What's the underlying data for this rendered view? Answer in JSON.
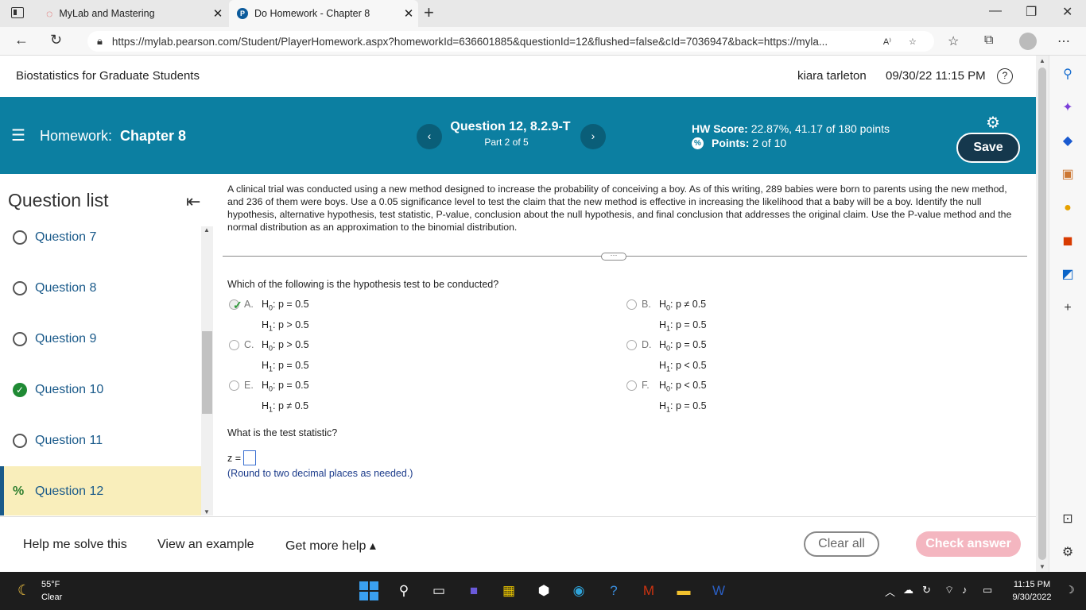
{
  "browser": {
    "tabs": [
      {
        "title": "MyLab and Mastering"
      },
      {
        "title": "Do Homework - Chapter 8"
      }
    ],
    "url": "https://mylab.pearson.com/Student/PlayerHomework.aspx?homeworkId=636601885&questionId=12&flushed=false&cId=7036947&back=https://myla..."
  },
  "header": {
    "course": "Biostatistics for Graduate Students",
    "user": "kiara tarleton",
    "datetime": "09/30/22 11:15 PM"
  },
  "banner": {
    "homework_prefix": "Homework:",
    "homework_name": "Chapter 8",
    "question_title": "Question 12, 8.2.9-T",
    "question_part": "Part 2 of 5",
    "hw_score_label": "HW Score:",
    "hw_score_value": "22.87%, 41.17 of 180 points",
    "points_label": "Points:",
    "points_value": "2 of 10",
    "save_label": "Save"
  },
  "question_list": {
    "title": "Question list",
    "items": [
      {
        "label": "Question 7",
        "status": "unanswered"
      },
      {
        "label": "Question 8",
        "status": "unanswered"
      },
      {
        "label": "Question 9",
        "status": "unanswered"
      },
      {
        "label": "Question 10",
        "status": "correct"
      },
      {
        "label": "Question 11",
        "status": "unanswered"
      },
      {
        "label": "Question 12",
        "status": "partial"
      }
    ]
  },
  "problem": {
    "text": "A clinical trial was conducted using a new method designed to increase the probability of conceiving a boy. As of this writing, 289 babies were born to parents using the new method, and 236 of them were boys. Use a 0.05 significance level to test the claim that the new method is effective in increasing the likelihood that a baby will be a boy. Identify the null hypothesis, alternative hypothesis, test statistic, P-value, conclusion about the null hypothesis, and final conclusion that addresses the original claim. Use the P-value method and the normal distribution as an approximation to the binomial distribution.",
    "q1": "Which of the following is the hypothesis test to be conducted?",
    "options": [
      {
        "letter": "A.",
        "h0": ": p = 0.5",
        "h1": ": p > 0.5",
        "selected": true
      },
      {
        "letter": "B.",
        "h0": ": p ≠ 0.5",
        "h1": ": p = 0.5",
        "selected": false
      },
      {
        "letter": "C.",
        "h0": ": p > 0.5",
        "h1": ": p = 0.5",
        "selected": false
      },
      {
        "letter": "D.",
        "h0": ": p = 0.5",
        "h1": ": p < 0.5",
        "selected": false
      },
      {
        "letter": "E.",
        "h0": ": p = 0.5",
        "h1": ": p ≠ 0.5",
        "selected": false
      },
      {
        "letter": "F.",
        "h0": ": p < 0.5",
        "h1": ": p = 0.5",
        "selected": false
      }
    ],
    "h_letter": "H",
    "h0_sub": "0",
    "h1_sub": "1",
    "q2": "What is the test statistic?",
    "z_label": "z =",
    "round_note": "(Round to two decimal places as needed.)"
  },
  "footer": {
    "help_solve": "Help me solve this",
    "view_example": "View an example",
    "get_help": "Get more help ▴",
    "clear_all": "Clear all",
    "check_answer": "Check answer"
  },
  "taskbar": {
    "temp": "55°F",
    "condition": "Clear",
    "time": "11:15 PM",
    "date": "9/30/2022"
  }
}
